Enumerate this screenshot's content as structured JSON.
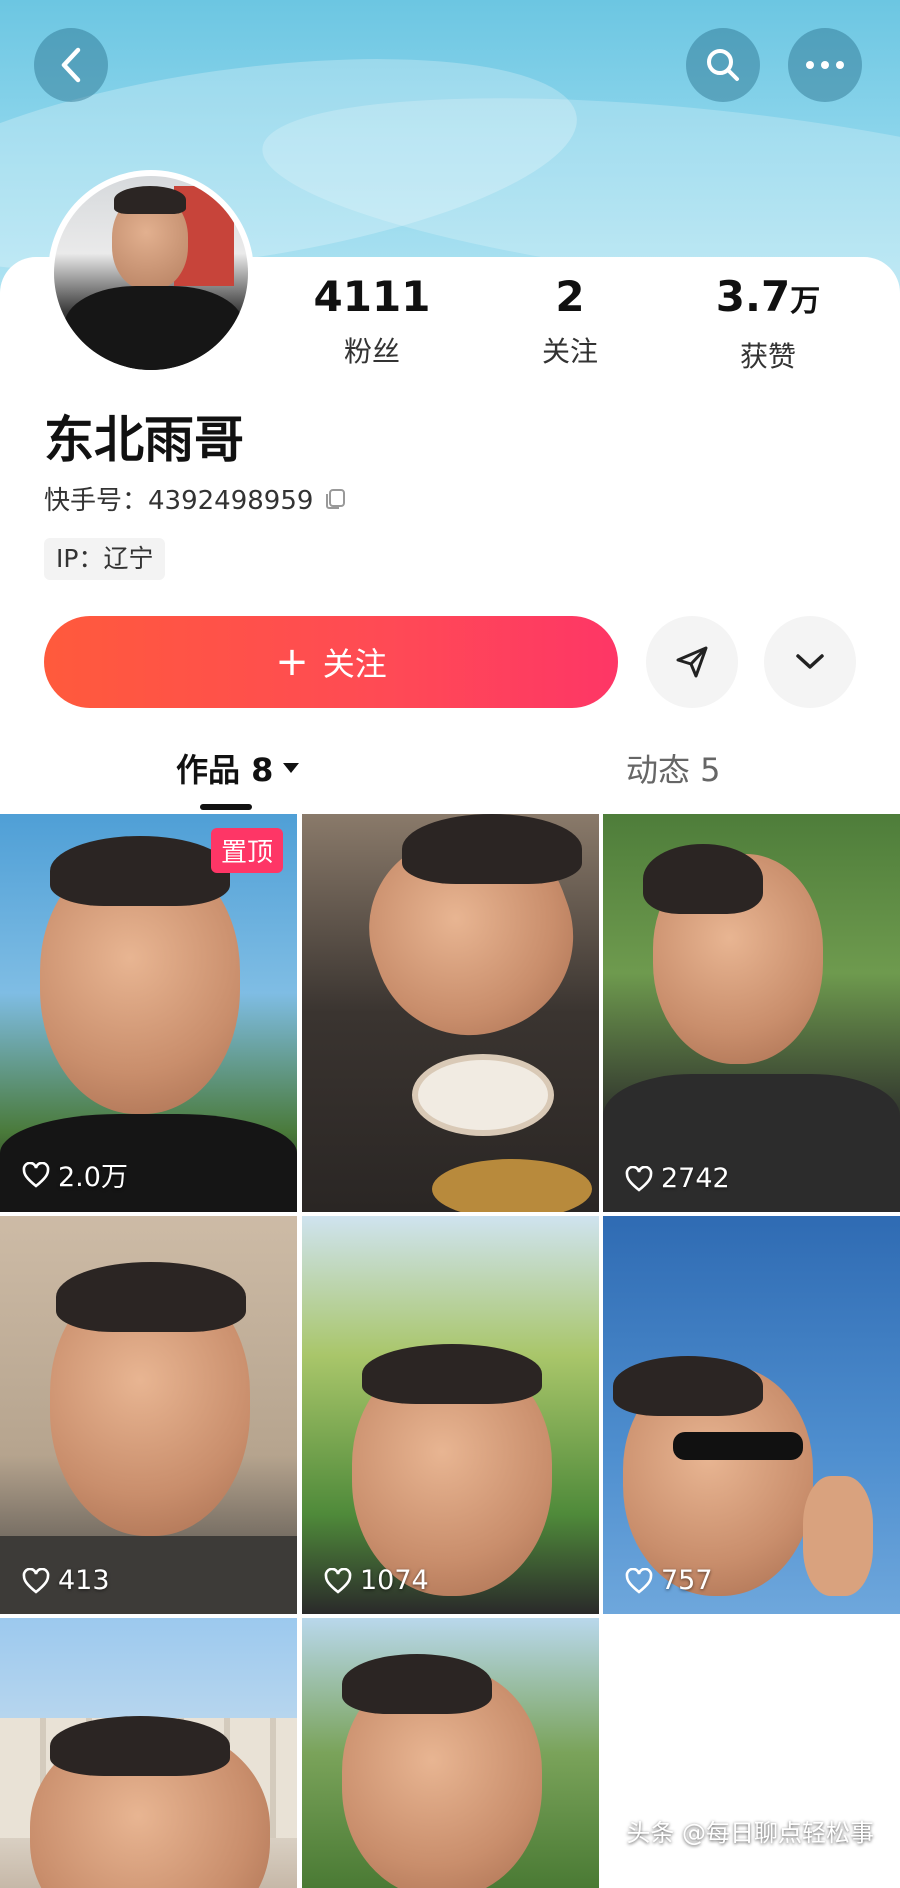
{
  "header": {
    "back_icon": "chevron-left-icon",
    "search_icon": "search-icon",
    "more_icon": "more-dots-icon"
  },
  "profile": {
    "stats": [
      {
        "value": "4111",
        "unit": "",
        "label": "粉丝"
      },
      {
        "value": "2",
        "unit": "",
        "label": "关注"
      },
      {
        "value": "3.7",
        "unit": "万",
        "label": "获赞"
      }
    ],
    "name": "东北雨哥",
    "uid_label": "快手号：",
    "uid_value": "4392498959",
    "ip": "IP：辽宁"
  },
  "actions": {
    "follow_label": "关注",
    "follow_plus": "+"
  },
  "tabs": [
    {
      "label": "作品 8",
      "active": true
    },
    {
      "label": "动态 5",
      "active": false
    }
  ],
  "videos": [
    {
      "likes": "2.0万",
      "pinned": "置顶"
    },
    {
      "likes": ""
    },
    {
      "likes": "2742"
    },
    {
      "likes": "413"
    },
    {
      "likes": "1074"
    },
    {
      "likes": "757"
    },
    {
      "likes": ""
    },
    {
      "likes": ""
    }
  ],
  "watermark": "头条 @每日聊点轻松事",
  "colors": {
    "accent": "#fe3666",
    "follow_start": "#ff5a3c",
    "header_bg": "#8ed6ec"
  }
}
